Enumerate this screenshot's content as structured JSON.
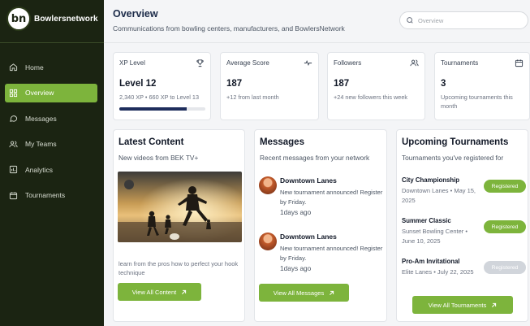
{
  "brand": {
    "name": "Bowlersnetwork"
  },
  "nav": [
    {
      "label": "Home",
      "icon": "home-icon",
      "active": false
    },
    {
      "label": "Overview",
      "icon": "grid-icon",
      "active": true
    },
    {
      "label": "Messages",
      "icon": "chat-icon",
      "active": false
    },
    {
      "label": "My Teams",
      "icon": "users-icon",
      "active": false
    },
    {
      "label": "Analytics",
      "icon": "chart-icon",
      "active": false
    },
    {
      "label": "Tournaments",
      "icon": "calendar-icon",
      "active": false
    }
  ],
  "header": {
    "title": "Overview",
    "subtitle": "Communications from bowling centers, manufacturers, and BowlersNetwork",
    "search_placeholder": "Overview"
  },
  "stats": {
    "xp": {
      "label": "XP Level",
      "value": "Level 12",
      "note": "2,340 XP • 660 XP to Level 13",
      "progress": 0.78,
      "icon": "trophy-icon"
    },
    "avg": {
      "label": "Average Score",
      "value": "187",
      "note": "+12 from last month",
      "icon": "pulse-icon"
    },
    "followers": {
      "label": "Followers",
      "value": "187",
      "note": "+24 new followers this week",
      "icon": "users-icon"
    },
    "tournaments": {
      "label": "Tournaments",
      "value": "3",
      "note": "Upcoming tournaments this month",
      "icon": "calendar-icon"
    }
  },
  "latest": {
    "title": "Latest Content",
    "subtitle": "New videos from BEK TV+",
    "description": "learn from the pros how to perfect your hook technique",
    "button": "View All Content"
  },
  "messages": {
    "title": "Messages",
    "subtitle": "Recent messages from your network",
    "items": [
      {
        "from": "Downtown Lanes",
        "text": "New tournament announced! Register by Friday.",
        "ago": "1days ago"
      },
      {
        "from": "Downtown Lanes",
        "text": "New tournament announced! Register by Friday.",
        "ago": "1days ago"
      }
    ],
    "button": "View All Messages"
  },
  "upcoming": {
    "title": "Upcoming Tournaments",
    "subtitle": "Tournaments you've registered for",
    "items": [
      {
        "name": "City Championship",
        "meta": "Downtown Lanes • May 15, 2025",
        "status": "Registered",
        "color": "#7db43c"
      },
      {
        "name": "Summer Classic",
        "meta": "Sunset Bowling Center • June 10, 2025",
        "status": "Registered",
        "color": "#7db43c"
      },
      {
        "name": "Pro-Am Invitational",
        "meta": "Elite Lanes • July 22, 2025",
        "status": "Registered",
        "color": "#d1d5db"
      }
    ],
    "button": "View All Tournaments"
  },
  "colors": {
    "accent": "#7db43c",
    "sidebar": "#1b2412",
    "navy": "#1e2d5c"
  }
}
